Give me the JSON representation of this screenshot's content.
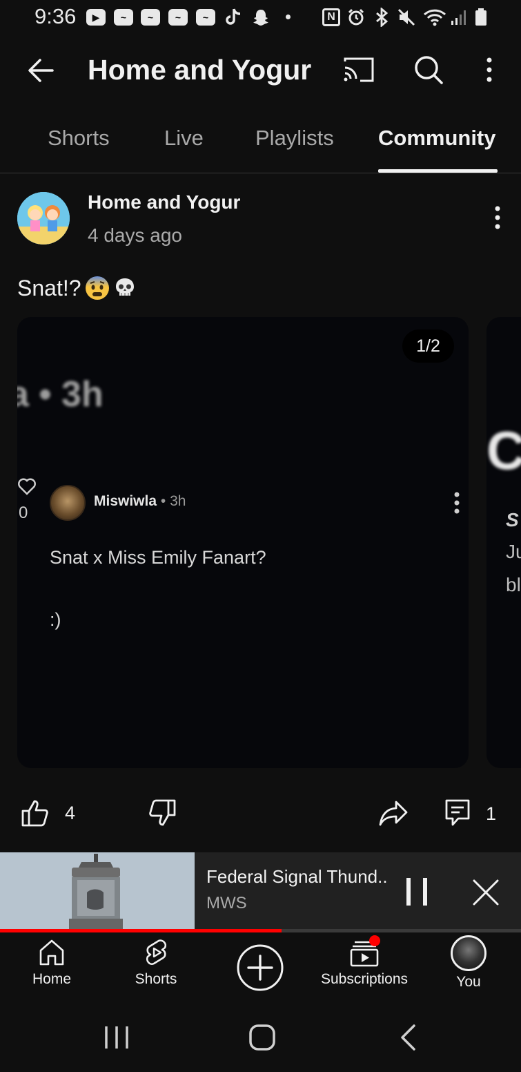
{
  "status_bar": {
    "time": "9:36",
    "nfc_label": "N"
  },
  "header": {
    "title": "Home and Yogur"
  },
  "tabs": [
    {
      "label": "Shorts"
    },
    {
      "label": "Live"
    },
    {
      "label": "Playlists"
    },
    {
      "label": "Community",
      "active": true
    }
  ],
  "post": {
    "author": "Home and Yogur",
    "time": "4 days ago",
    "text": "Snat!?",
    "emojis": [
      "fearful-face",
      "skull"
    ],
    "image_counter": "1/2",
    "image": {
      "blurred_header": "a • 3h",
      "like_count": "0",
      "inner_author": "Miswiwla",
      "inner_time": "3h",
      "inner_text_1": "Snat x Miss Emily Fanart?",
      "inner_text_2": ":)",
      "next_image_peek": [
        "C",
        "S",
        "Ju",
        "bl"
      ]
    },
    "likes": "4",
    "comments": "1"
  },
  "mini_player": {
    "title": "Federal Signal Thund..",
    "channel": "MWS",
    "progress": 0.54
  },
  "bottom_nav": [
    {
      "label": "Home",
      "icon": "home-icon"
    },
    {
      "label": "Shorts",
      "icon": "shorts-icon"
    },
    {
      "label": "",
      "icon": "create-icon"
    },
    {
      "label": "Subscriptions",
      "icon": "subscriptions-icon",
      "badge": true
    },
    {
      "label": "You",
      "icon": "avatar"
    }
  ],
  "colors": {
    "accent": "#ff0000",
    "background": "#0f0f0f",
    "muted_text": "#aaaaaa"
  }
}
